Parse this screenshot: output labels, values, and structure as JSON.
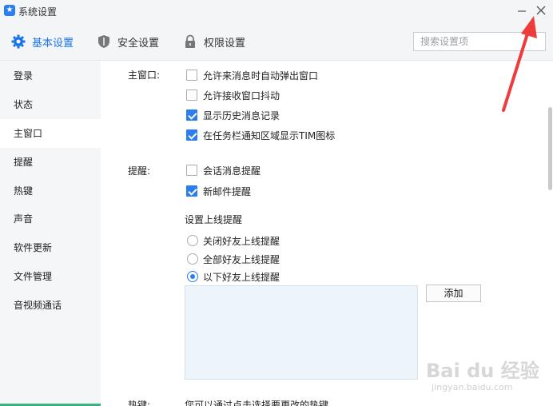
{
  "window": {
    "title": "系统设置",
    "logo_glyph": "★"
  },
  "toolbar": {
    "tabs": [
      {
        "label": "基本设置",
        "icon": "gear-icon",
        "active": true
      },
      {
        "label": "安全设置",
        "icon": "shield-icon",
        "active": false
      },
      {
        "label": "权限设置",
        "icon": "lock-icon",
        "active": false
      }
    ],
    "search_placeholder": "搜索设置项"
  },
  "sidebar": {
    "items": [
      {
        "label": "登录"
      },
      {
        "label": "状态"
      },
      {
        "label": "主窗口",
        "active": true
      },
      {
        "label": "提醒"
      },
      {
        "label": "热键"
      },
      {
        "label": "声音"
      },
      {
        "label": "软件更新"
      },
      {
        "label": "文件管理"
      },
      {
        "label": "音视频通话"
      }
    ]
  },
  "main_window": {
    "label": "主窗口:",
    "options": [
      {
        "label": "允许来消息时自动弹出窗口",
        "checked": false
      },
      {
        "label": "允许接收窗口抖动",
        "checked": false
      },
      {
        "label": "显示历史消息记录",
        "checked": true
      },
      {
        "label": "在任务栏通知区域显示TIM图标",
        "checked": true
      }
    ]
  },
  "reminder": {
    "label": "提醒:",
    "options": [
      {
        "label": "会话消息提醒",
        "checked": false
      },
      {
        "label": "新邮件提醒",
        "checked": true
      }
    ],
    "online_title": "设置上线提醒",
    "online_options": [
      {
        "label": "关闭好友上线提醒",
        "selected": false
      },
      {
        "label": "全部好友上线提醒",
        "selected": false
      },
      {
        "label": "以下好友上线提醒",
        "selected": true
      }
    ],
    "add_button": "添加"
  },
  "hotkey_partial": {
    "label": "热键:",
    "text": "您可以通过点击选择要更改的热键"
  },
  "watermark": {
    "text": "Bai du 经验",
    "sub": "jingyan.baidu.com"
  },
  "colors": {
    "accent": "#2b7df0",
    "arrow": "#ee3b3b"
  }
}
